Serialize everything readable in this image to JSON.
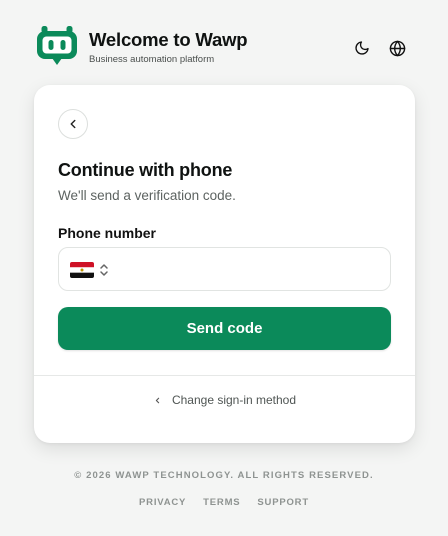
{
  "header": {
    "title": "Welcome to Wawp",
    "subtitle": "Business automation platform",
    "logo_icon": "robot-logo-icon",
    "theme_icon": "moon-icon",
    "language_icon": "globe-icon"
  },
  "card": {
    "back_icon": "chevron-left-icon",
    "title": "Continue with phone",
    "subtitle": "We'll send a verification code.",
    "phone": {
      "label": "Phone number",
      "country_flag": "egypt-flag-icon",
      "selector_icon": "chevrons-up-down-icon",
      "value": "",
      "placeholder": ""
    },
    "send_button_label": "Send code",
    "change_method_label": "Change sign-in method"
  },
  "footer": {
    "copyright": "© 2026 WAWP TECHNOLOGY. ALL RIGHTS RESERVED.",
    "links": [
      "PRIVACY",
      "TERMS",
      "SUPPORT"
    ]
  },
  "colors": {
    "brand": "#0b8a5a",
    "background": "#f4f5f4",
    "card": "#ffffff"
  }
}
